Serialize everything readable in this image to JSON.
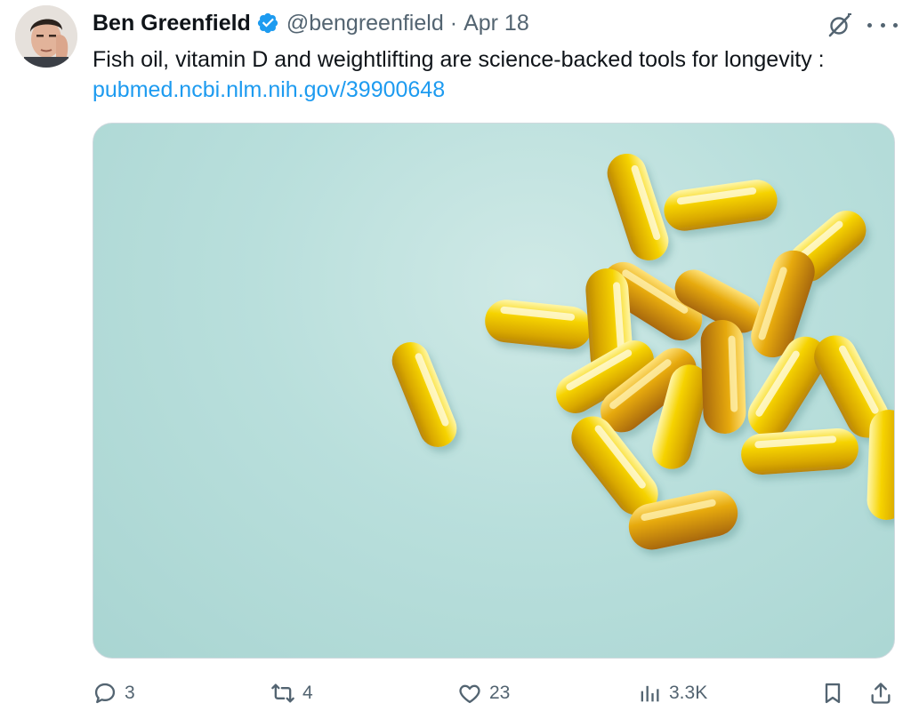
{
  "tweet": {
    "author_name": "Ben Greenfield",
    "handle": "@bengreenfield",
    "separator": "·",
    "date": "Apr 18",
    "text": "Fish oil, vitamin D and weightlifting are science-backed tools for longevity :",
    "link": "pubmed.ncbi.nlm.nih.gov/39900648"
  },
  "actions": {
    "replies": "3",
    "reposts": "4",
    "likes": "23",
    "views": "3.3K"
  },
  "icons": {
    "verified": "verified-badge-icon",
    "grok": "grok-icon",
    "more": "more-icon",
    "reply": "reply-icon",
    "repost": "repost-icon",
    "like": "like-icon",
    "views": "views-icon",
    "bookmark": "bookmark-icon",
    "share": "share-icon"
  },
  "colors": {
    "link": "#1d9bf0",
    "secondary_text": "#536471",
    "verified": "#1d9bf0"
  }
}
